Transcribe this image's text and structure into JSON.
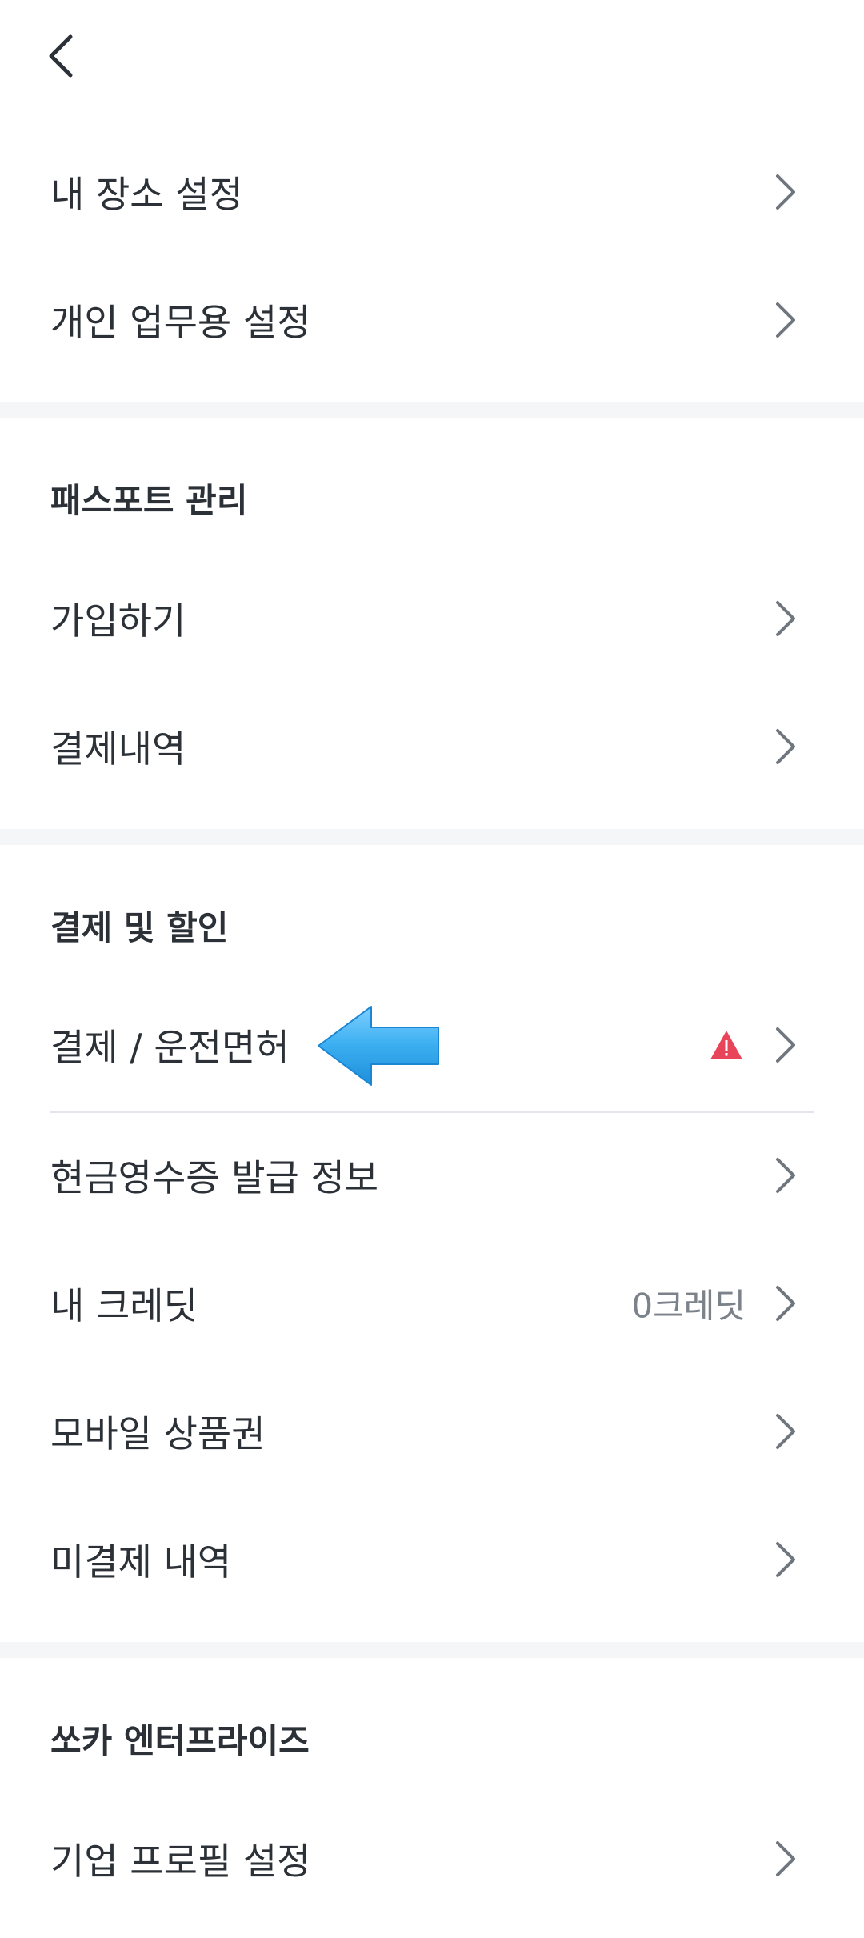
{
  "header": {
    "back_icon": "chevron-left-icon"
  },
  "groups": [
    {
      "items": [
        {
          "label": "내 장소 설정"
        },
        {
          "label": "개인 업무용 설정"
        }
      ]
    },
    {
      "title": "패스포트 관리",
      "items": [
        {
          "label": "가입하기"
        },
        {
          "label": "결제내역"
        }
      ]
    },
    {
      "title": "결제 및 할인",
      "items": [
        {
          "label": "결제 / 운전면허",
          "warning_icon": "warning-triangle-icon",
          "warning_color": "#e8445a"
        },
        {
          "label": "현금영수증 발급 정보"
        },
        {
          "label": "내 크레딧",
          "value": "0크레딧"
        },
        {
          "label": "모바일 상품권"
        },
        {
          "label": "미결제 내역"
        }
      ]
    },
    {
      "title": "쏘카 엔터프라이즈",
      "items": [
        {
          "label": "기업 프로필 설정"
        }
      ]
    }
  ],
  "annotation": {
    "icon": "left-pointing-arrow-icon",
    "color": "#3aaef0"
  },
  "colors": {
    "text": "#2b3137",
    "secondary": "#7b828a",
    "chevron": "#6f767e",
    "band": "#f5f6f8"
  }
}
